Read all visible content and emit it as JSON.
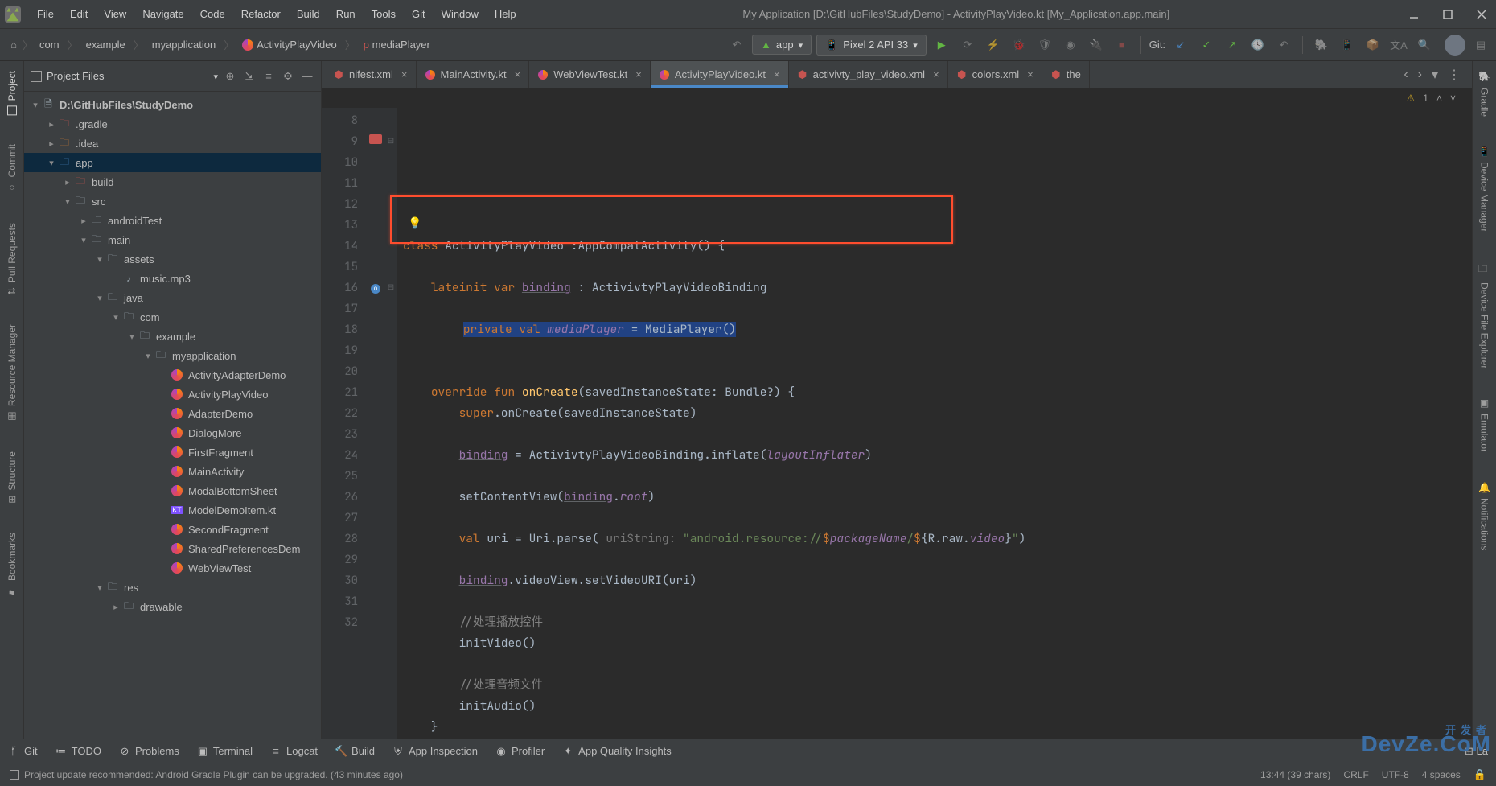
{
  "title": "My Application [D:\\GitHubFiles\\StudyDemo] - ActivityPlayVideo.kt [My_Application.app.main]",
  "menu": [
    "File",
    "Edit",
    "View",
    "Navigate",
    "Code",
    "Refactor",
    "Build",
    "Run",
    "Tools",
    "Git",
    "Window",
    "Help"
  ],
  "breadcrumb": [
    "com",
    "example",
    "myapplication",
    "ActivityPlayVideo",
    "mediaPlayer"
  ],
  "runConfig": "app",
  "device": "Pixel 2 API 33",
  "gitLabel": "Git:",
  "leftStripe": [
    {
      "label": "Project",
      "active": true
    },
    {
      "label": "Commit"
    },
    {
      "label": "Pull Requests"
    },
    {
      "label": "Resource Manager"
    },
    {
      "label": "Structure"
    },
    {
      "label": "Bookmarks"
    }
  ],
  "rightStripe": [
    {
      "label": "Gradle"
    },
    {
      "label": "Device Manager"
    },
    {
      "label": "Device File Explorer"
    },
    {
      "label": "Emulator"
    },
    {
      "label": "Notifications"
    }
  ],
  "projectPanel": {
    "title": "Project Files",
    "root": "D:\\GitHubFiles\\StudyDemo",
    "items": [
      {
        "indent": 1,
        "chev": "right",
        "icon": "folder-red",
        "label": ".gradle"
      },
      {
        "indent": 1,
        "chev": "right",
        "icon": "folder-orange",
        "label": ".idea"
      },
      {
        "indent": 1,
        "chev": "down",
        "icon": "folder-blue",
        "label": "app",
        "sel": true
      },
      {
        "indent": 2,
        "chev": "right",
        "icon": "folder-red",
        "label": "build"
      },
      {
        "indent": 2,
        "chev": "down",
        "icon": "folder",
        "label": "src"
      },
      {
        "indent": 3,
        "chev": "right",
        "icon": "folder",
        "label": "androidTest"
      },
      {
        "indent": 3,
        "chev": "down",
        "icon": "folder",
        "label": "main"
      },
      {
        "indent": 4,
        "chev": "down",
        "icon": "folder",
        "label": "assets"
      },
      {
        "indent": 5,
        "chev": "",
        "icon": "audio",
        "label": "music.mp3"
      },
      {
        "indent": 4,
        "chev": "down",
        "icon": "folder",
        "label": "java"
      },
      {
        "indent": 5,
        "chev": "down",
        "icon": "folder",
        "label": "com"
      },
      {
        "indent": 6,
        "chev": "down",
        "icon": "folder",
        "label": "example"
      },
      {
        "indent": 7,
        "chev": "down",
        "icon": "folder",
        "label": "myapplication"
      },
      {
        "indent": 8,
        "chev": "",
        "icon": "kt",
        "label": "ActivityAdapterDemo"
      },
      {
        "indent": 8,
        "chev": "",
        "icon": "kt",
        "label": "ActivityPlayVideo"
      },
      {
        "indent": 8,
        "chev": "",
        "icon": "kt",
        "label": "AdapterDemo"
      },
      {
        "indent": 8,
        "chev": "",
        "icon": "kt",
        "label": "DialogMore"
      },
      {
        "indent": 8,
        "chev": "",
        "icon": "kt",
        "label": "FirstFragment"
      },
      {
        "indent": 8,
        "chev": "",
        "icon": "kt",
        "label": "MainActivity"
      },
      {
        "indent": 8,
        "chev": "",
        "icon": "kt",
        "label": "ModalBottomSheet"
      },
      {
        "indent": 8,
        "chev": "",
        "icon": "ktf",
        "label": "ModelDemoItem.kt"
      },
      {
        "indent": 8,
        "chev": "",
        "icon": "kt",
        "label": "SecondFragment"
      },
      {
        "indent": 8,
        "chev": "",
        "icon": "kt",
        "label": "SharedPreferencesDem"
      },
      {
        "indent": 8,
        "chev": "",
        "icon": "kt",
        "label": "WebViewTest"
      },
      {
        "indent": 4,
        "chev": "down",
        "icon": "folder",
        "label": "res"
      },
      {
        "indent": 5,
        "chev": "right",
        "icon": "folder",
        "label": "drawable"
      }
    ]
  },
  "tabs": [
    {
      "label": "nifest.xml",
      "icon": "xml",
      "close": true,
      "clipped": true
    },
    {
      "label": "MainActivity.kt",
      "icon": "kt",
      "close": true
    },
    {
      "label": "WebViewTest.kt",
      "icon": "kt",
      "close": true
    },
    {
      "label": "ActivityPlayVideo.kt",
      "icon": "kt",
      "close": true,
      "active": true
    },
    {
      "label": "activivty_play_video.xml",
      "icon": "xml",
      "close": true
    },
    {
      "label": "colors.xml",
      "icon": "xml",
      "close": true
    },
    {
      "label": "the",
      "icon": "xml",
      "close": false,
      "clipped": true
    }
  ],
  "editorWarn": "1",
  "lines": {
    "l8": "",
    "l9": {
      "p": [
        {
          "t": "class ",
          "c": "kw"
        },
        {
          "t": "ActivityPlayVideo :AppCompatActivity() {"
        }
      ]
    },
    "l10": "",
    "l11": {
      "p": [
        {
          "t": "    "
        },
        {
          "t": "lateinit var ",
          "c": "kw"
        },
        {
          "t": "binding",
          "c": "purple ul"
        },
        {
          "t": " : ActivivtyPlayVideoBinding"
        }
      ]
    },
    "l12": "",
    "l13": {
      "p": [
        {
          "t": "    "
        },
        {
          "t": "private val ",
          "c": "kw",
          "sel": true
        },
        {
          "t": "mediaPlayer",
          "c": "purple-i",
          "sel": true
        },
        {
          "t": " = MediaPlayer()",
          "sel": true
        }
      ]
    },
    "l14": "",
    "l15": "",
    "l16": {
      "p": [
        {
          "t": "    "
        },
        {
          "t": "override fun ",
          "c": "kw"
        },
        {
          "t": "onCreate",
          "c": "fn"
        },
        {
          "t": "(savedInstanceState: Bundle?) {"
        }
      ]
    },
    "l17": {
      "p": [
        {
          "t": "        "
        },
        {
          "t": "super",
          "c": "kw"
        },
        {
          "t": ".onCreate(savedInstanceState)"
        }
      ]
    },
    "l18": "",
    "l19": {
      "p": [
        {
          "t": "        "
        },
        {
          "t": "binding",
          "c": "purple ul"
        },
        {
          "t": " = ActivivtyPlayVideoBinding.inflate("
        },
        {
          "t": "layoutInflater",
          "c": "purple-i"
        },
        {
          "t": ")"
        }
      ]
    },
    "l20": "",
    "l21": {
      "p": [
        {
          "t": "        setContentView("
        },
        {
          "t": "binding",
          "c": "purple ul"
        },
        {
          "t": "."
        },
        {
          "t": "root",
          "c": "purple-i"
        },
        {
          "t": ")"
        }
      ]
    },
    "l22": "",
    "l23": {
      "p": [
        {
          "t": "        "
        },
        {
          "t": "val ",
          "c": "kw"
        },
        {
          "t": "uri = Uri.parse( "
        },
        {
          "t": "uriString: ",
          "c": "param-hint"
        },
        {
          "t": "\"android.resource://",
          "c": "str"
        },
        {
          "t": "$",
          "c": "kw"
        },
        {
          "t": "packageName",
          "c": "purple-i"
        },
        {
          "t": "/",
          "c": "str"
        },
        {
          "t": "$",
          "c": "kw"
        },
        {
          "t": "{R.raw."
        },
        {
          "t": "video",
          "c": "purple-i"
        },
        {
          "t": "}"
        },
        {
          "t": "\"",
          "c": "str"
        },
        {
          "t": ")"
        }
      ]
    },
    "l24": "",
    "l25": {
      "p": [
        {
          "t": "        "
        },
        {
          "t": "binding",
          "c": "purple ul"
        },
        {
          "t": ".videoView.setVideoURI(uri)"
        }
      ]
    },
    "l26": "",
    "l27": {
      "p": [
        {
          "t": "        "
        },
        {
          "t": "//处理播放控件",
          "c": "cmt"
        }
      ]
    },
    "l28": {
      "p": [
        {
          "t": "        initVideo()"
        }
      ]
    },
    "l29": "",
    "l30": {
      "p": [
        {
          "t": "        "
        },
        {
          "t": "//处理音频文件",
          "c": "cmt"
        }
      ]
    },
    "l31": {
      "p": [
        {
          "t": "        initAudio()"
        }
      ]
    },
    "l32": {
      "p": [
        {
          "t": "    }"
        }
      ]
    }
  },
  "bottomTools": [
    "Git",
    "TODO",
    "Problems",
    "Terminal",
    "Logcat",
    "Build",
    "App Inspection",
    "Profiler",
    "App Quality Insights"
  ],
  "status": {
    "message": "Project update recommended: Android Gradle Plugin can be upgraded. (43 minutes ago)",
    "pos": "13:44 (39 chars)",
    "lineEnding": "CRLF",
    "encoding": "UTF-8",
    "indent": "4 spaces"
  },
  "watermark": {
    "en": "DevZe.CoM",
    "cn": "开发者"
  }
}
